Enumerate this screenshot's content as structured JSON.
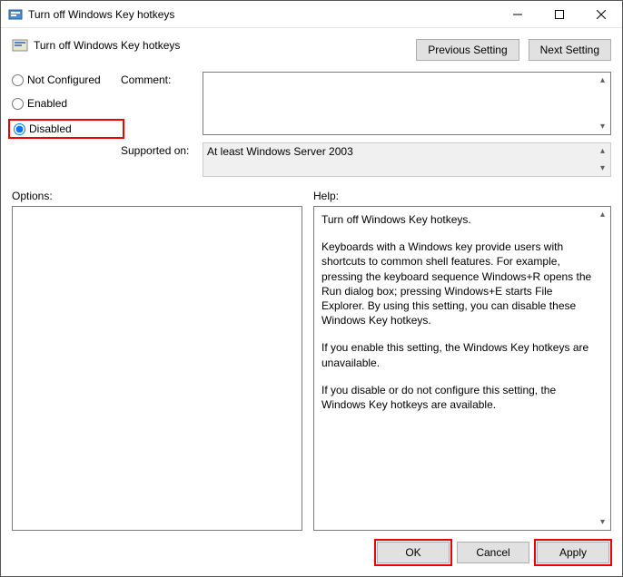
{
  "titlebar": {
    "text": "Turn off Windows Key hotkeys"
  },
  "header": {
    "title": "Turn off Windows Key hotkeys",
    "prev": "Previous Setting",
    "next": "Next Setting"
  },
  "radios": {
    "not_configured": "Not Configured",
    "enabled": "Enabled",
    "disabled": "Disabled"
  },
  "fields": {
    "comment_label": "Comment:",
    "comment_value": "",
    "supported_label": "Supported on:",
    "supported_value": "At least Windows Server 2003"
  },
  "panels": {
    "options_label": "Options:",
    "help_label": "Help:"
  },
  "help": {
    "p1": "Turn off Windows Key hotkeys.",
    "p2": "Keyboards with a Windows key provide users with shortcuts to common shell features. For example, pressing the keyboard sequence Windows+R opens the Run dialog box; pressing Windows+E starts File Explorer. By using this setting, you can disable these Windows Key hotkeys.",
    "p3": "If you enable this setting, the Windows Key hotkeys are unavailable.",
    "p4": "If you disable or do not configure this setting, the Windows Key hotkeys are available."
  },
  "footer": {
    "ok": "OK",
    "cancel": "Cancel",
    "apply": "Apply"
  }
}
